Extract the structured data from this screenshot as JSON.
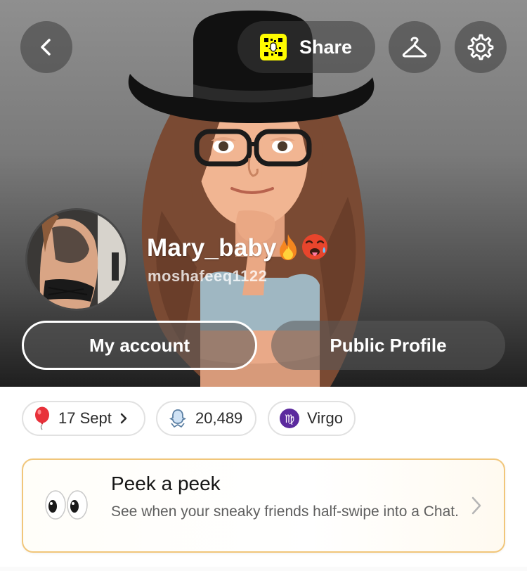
{
  "header": {
    "share_label": "Share"
  },
  "profile": {
    "display_name": "Mary_baby",
    "name_emojis": [
      "fire-emoji",
      "hot-face-emoji"
    ],
    "username": "moshafeeq1122"
  },
  "buttons": {
    "my_account": "My account",
    "public_profile": "Public Profile"
  },
  "chips": {
    "birthday": "17 Sept",
    "score": "20,489",
    "zodiac": "Virgo"
  },
  "peek": {
    "title": "Peek a peek",
    "description": "See when your sneaky friends half-swipe into a Chat."
  },
  "colors": {
    "snap_yellow": "#fffc00",
    "zodiac_purple": "#5b2a9e",
    "peek_border": "#f1c67a"
  },
  "icons": {
    "back": "chevron-left-icon",
    "snapcode": "snapcode-icon",
    "outfit": "hanger-icon",
    "settings": "gear-icon",
    "birthday": "balloon-icon",
    "score": "ghost-score-icon",
    "zodiac": "virgo-icon",
    "peek": "eyes-icon",
    "peek_chevron": "chevron-right-icon"
  }
}
